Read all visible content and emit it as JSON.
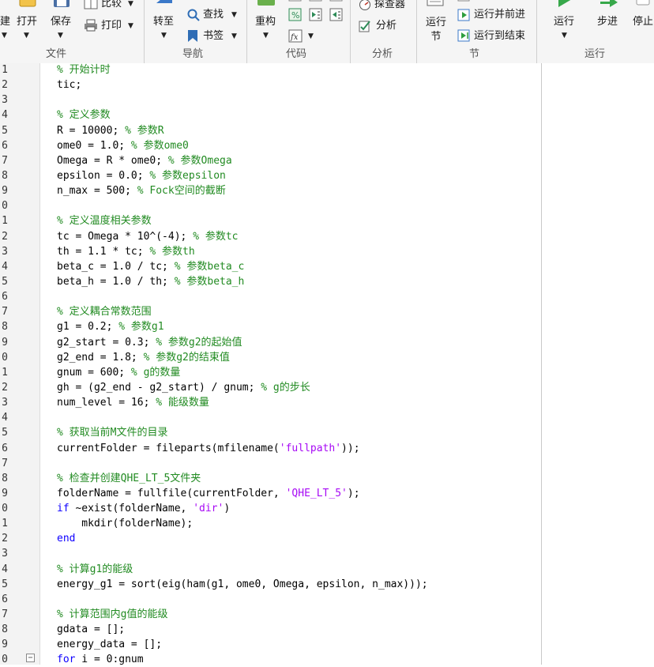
{
  "toolstrip": {
    "file_group": {
      "new_label": "建",
      "open_label": "打开",
      "save_label": "保存",
      "compare_label": "比较",
      "print_label": "打印",
      "group_label": "文件"
    },
    "nav_group": {
      "goto_label": "转至",
      "find_label": "查找",
      "bookmark_label": "书签",
      "group_label": "导航"
    },
    "code_group": {
      "refactor_label": "重构",
      "group_label": "代码"
    },
    "analyze_group": {
      "profiler_label": "探查器",
      "analyze_label": "分析",
      "group_label": "分析"
    },
    "section_group": {
      "run_section_label": "运行节",
      "run_and_advance_label": "运行并前进",
      "run_to_end_label": "运行到结束",
      "group_label": "节"
    },
    "run_group": {
      "run_label": "运行",
      "step_label": "步进",
      "stop_label": "停止",
      "group_label": "运行"
    }
  },
  "editor": {
    "lines": [
      {
        "no": "1",
        "tokens": [
          {
            "t": "% 开始计时",
            "c": "cmt"
          }
        ]
      },
      {
        "no": "2",
        "tokens": [
          {
            "t": "tic;",
            "c": "code"
          }
        ]
      },
      {
        "no": "3",
        "tokens": []
      },
      {
        "no": "4",
        "tokens": [
          {
            "t": "% 定义参数",
            "c": "cmt"
          }
        ]
      },
      {
        "no": "5",
        "tokens": [
          {
            "t": "R = 10000; ",
            "c": "code"
          },
          {
            "t": "% 参数R",
            "c": "cmt"
          }
        ]
      },
      {
        "no": "6",
        "tokens": [
          {
            "t": "ome0 = 1.0; ",
            "c": "code"
          },
          {
            "t": "% 参数ome0",
            "c": "cmt"
          }
        ]
      },
      {
        "no": "7",
        "tokens": [
          {
            "t": "Omega = R * ome0; ",
            "c": "code"
          },
          {
            "t": "% 参数Omega",
            "c": "cmt"
          }
        ]
      },
      {
        "no": "8",
        "tokens": [
          {
            "t": "epsilon = 0.0; ",
            "c": "code"
          },
          {
            "t": "% 参数epsilon",
            "c": "cmt"
          }
        ]
      },
      {
        "no": "9",
        "tokens": [
          {
            "t": "n_max = 500; ",
            "c": "code"
          },
          {
            "t": "% Fock空间的截断",
            "c": "cmt"
          }
        ]
      },
      {
        "no": "0",
        "tokens": []
      },
      {
        "no": "1",
        "tokens": [
          {
            "t": "% 定义温度相关参数",
            "c": "cmt"
          }
        ]
      },
      {
        "no": "2",
        "tokens": [
          {
            "t": "tc = Omega * 10^(-4); ",
            "c": "code"
          },
          {
            "t": "% 参数tc",
            "c": "cmt"
          }
        ]
      },
      {
        "no": "3",
        "tokens": [
          {
            "t": "th = 1.1 * tc; ",
            "c": "code"
          },
          {
            "t": "% 参数th",
            "c": "cmt"
          }
        ]
      },
      {
        "no": "4",
        "tokens": [
          {
            "t": "beta_c = 1.0 / tc; ",
            "c": "code"
          },
          {
            "t": "% 参数beta_c",
            "c": "cmt"
          }
        ]
      },
      {
        "no": "5",
        "tokens": [
          {
            "t": "beta_h = 1.0 / th; ",
            "c": "code"
          },
          {
            "t": "% 参数beta_h",
            "c": "cmt"
          }
        ]
      },
      {
        "no": "6",
        "tokens": []
      },
      {
        "no": "7",
        "tokens": [
          {
            "t": "% 定义耦合常数范围",
            "c": "cmt"
          }
        ]
      },
      {
        "no": "8",
        "tokens": [
          {
            "t": "g1 = 0.2; ",
            "c": "code"
          },
          {
            "t": "% 参数g1",
            "c": "cmt"
          }
        ]
      },
      {
        "no": "9",
        "tokens": [
          {
            "t": "g2_start = 0.3; ",
            "c": "code"
          },
          {
            "t": "% 参数g2的起始值",
            "c": "cmt"
          }
        ]
      },
      {
        "no": "0",
        "tokens": [
          {
            "t": "g2_end = 1.8; ",
            "c": "code"
          },
          {
            "t": "% 参数g2的结束值",
            "c": "cmt"
          }
        ]
      },
      {
        "no": "1",
        "tokens": [
          {
            "t": "gnum = 600; ",
            "c": "code"
          },
          {
            "t": "% g的数量",
            "c": "cmt"
          }
        ]
      },
      {
        "no": "2",
        "tokens": [
          {
            "t": "gh = (g2_end - g2_start) / gnum; ",
            "c": "code"
          },
          {
            "t": "% g的步长",
            "c": "cmt"
          }
        ]
      },
      {
        "no": "3",
        "tokens": [
          {
            "t": "num_level = 16; ",
            "c": "code"
          },
          {
            "t": "% 能级数量",
            "c": "cmt"
          }
        ]
      },
      {
        "no": "4",
        "tokens": []
      },
      {
        "no": "5",
        "tokens": [
          {
            "t": "% 获取当前M文件的目录",
            "c": "cmt"
          }
        ]
      },
      {
        "no": "6",
        "tokens": [
          {
            "t": "currentFolder = fileparts(mfilename(",
            "c": "code"
          },
          {
            "t": "'fullpath'",
            "c": "str"
          },
          {
            "t": "));",
            "c": "code"
          }
        ]
      },
      {
        "no": "7",
        "tokens": []
      },
      {
        "no": "8",
        "tokens": [
          {
            "t": "% 检查并创建QHE_LT_5文件夹",
            "c": "cmt"
          }
        ]
      },
      {
        "no": "9",
        "tokens": [
          {
            "t": "folderName = fullfile(currentFolder, ",
            "c": "code"
          },
          {
            "t": "'QHE_LT_5'",
            "c": "str"
          },
          {
            "t": ");",
            "c": "code"
          }
        ]
      },
      {
        "no": "0",
        "tokens": [
          {
            "t": "if",
            "c": "kw"
          },
          {
            "t": " ~exist(folderName, ",
            "c": "code"
          },
          {
            "t": "'dir'",
            "c": "str"
          },
          {
            "t": ")",
            "c": "code"
          }
        ]
      },
      {
        "no": "1",
        "tokens": [
          {
            "t": "    mkdir(folderName);",
            "c": "code"
          }
        ]
      },
      {
        "no": "2",
        "tokens": [
          {
            "t": "end",
            "c": "kw"
          }
        ]
      },
      {
        "no": "3",
        "tokens": []
      },
      {
        "no": "4",
        "tokens": [
          {
            "t": "% 计算g1的能级",
            "c": "cmt"
          }
        ]
      },
      {
        "no": "5",
        "tokens": [
          {
            "t": "energy_g1 = sort(eig(ham(g1, ome0, Omega, epsilon, n_max)));",
            "c": "code"
          }
        ]
      },
      {
        "no": "6",
        "tokens": []
      },
      {
        "no": "7",
        "tokens": [
          {
            "t": "% 计算范围内g值的能级",
            "c": "cmt"
          }
        ]
      },
      {
        "no": "8",
        "tokens": [
          {
            "t": "gdata = [];",
            "c": "code"
          }
        ]
      },
      {
        "no": "9",
        "tokens": [
          {
            "t": "energy_data = [];",
            "c": "code"
          }
        ]
      },
      {
        "no": "0",
        "tokens": [
          {
            "t": "for",
            "c": "kw"
          },
          {
            "t": " i = 0:gnum",
            "c": "code"
          }
        ]
      }
    ],
    "fold_symbol": "−"
  },
  "colors": {
    "comment": "#228b22",
    "keyword": "#0e00ff",
    "string": "#a709f5",
    "toolstrip_bg": "#f5f5f5",
    "gutter_bg": "#f3f3f3"
  },
  "icons": [
    "new-file-icon",
    "open-folder-icon",
    "save-disk-icon",
    "compare-icon",
    "print-icon",
    "goto-icon",
    "search-icon",
    "bookmark-icon",
    "refactor-icon",
    "comment-icon",
    "indent-icon",
    "outdent-icon",
    "fx-icon",
    "profiler-icon",
    "analyze-icon",
    "run-section-icon",
    "run-advance-icon",
    "run-to-end-icon",
    "run-icon",
    "step-icon"
  ]
}
